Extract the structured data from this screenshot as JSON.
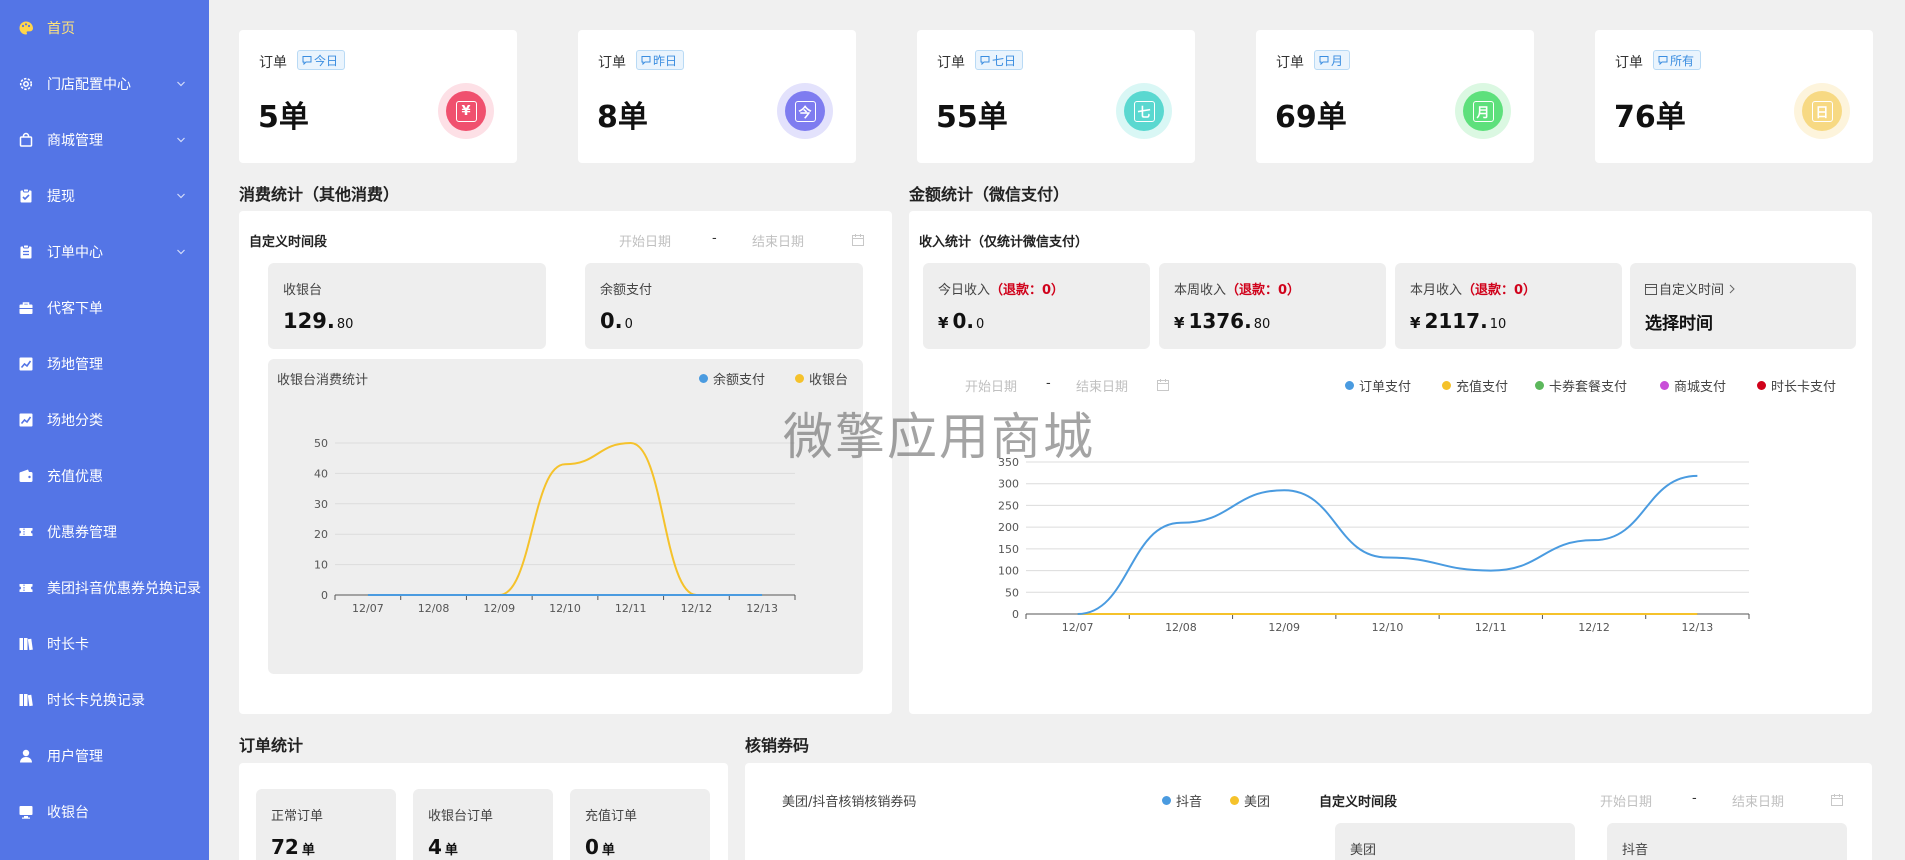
{
  "sidebar": {
    "items": [
      {
        "label": "首页",
        "icon": "palette-icon",
        "active": true,
        "chevron": false
      },
      {
        "label": "门店配置中心",
        "icon": "gear-icon",
        "chevron": true
      },
      {
        "label": "商城管理",
        "icon": "shopping-bag-icon",
        "chevron": true
      },
      {
        "label": "提现",
        "icon": "clipboard-check-icon",
        "chevron": true
      },
      {
        "label": "订单中心",
        "icon": "clipboard-list-icon",
        "chevron": true
      },
      {
        "label": "代客下单",
        "icon": "briefcase-icon",
        "chevron": false
      },
      {
        "label": "场地管理",
        "icon": "chart-up-icon",
        "chevron": false
      },
      {
        "label": "场地分类",
        "icon": "chart-up-icon",
        "chevron": false
      },
      {
        "label": "充值优惠",
        "icon": "wallet-icon",
        "chevron": false
      },
      {
        "label": "优惠券管理",
        "icon": "ticket-icon",
        "chevron": false
      },
      {
        "label": "美团抖音优惠券兑换记录",
        "icon": "ticket-icon",
        "chevron": false
      },
      {
        "label": "时长卡",
        "icon": "card-stack-icon",
        "chevron": false
      },
      {
        "label": "时长卡兑换记录",
        "icon": "card-stack-icon",
        "chevron": false
      },
      {
        "label": "用户管理",
        "icon": "user-icon",
        "chevron": false
      },
      {
        "label": "收银台",
        "icon": "monitor-icon",
        "chevron": false
      }
    ]
  },
  "stats": [
    {
      "title": "订单",
      "tag": "今日",
      "value": "5单",
      "badge_char": "¥",
      "badge_color": "#f0506e",
      "ring_color": "#fde0e6"
    },
    {
      "title": "订单",
      "tag": "昨日",
      "value": "8单",
      "badge_char": "今",
      "badge_color": "#7e7cf0",
      "ring_color": "#e3e2fc"
    },
    {
      "title": "订单",
      "tag": "七日",
      "value": "55单",
      "badge_char": "七",
      "badge_color": "#5ad8d0",
      "ring_color": "#d9f7f5"
    },
    {
      "title": "订单",
      "tag": "月",
      "value": "69单",
      "badge_char": "月",
      "badge_color": "#5ee07c",
      "ring_color": "#dbf8e2"
    },
    {
      "title": "订单",
      "tag": "所有",
      "value": "76单",
      "badge_char": "日",
      "badge_color": "#f7d983",
      "ring_color": "#fdf4dc"
    }
  ],
  "consume": {
    "section_title": "消费统计（其他消费）",
    "range_label": "自定义时间段",
    "start_placeholder": "开始日期",
    "dash": "-",
    "end_placeholder": "结束日期",
    "box1_label": "收银台",
    "box1_int": "129.",
    "box1_dec": "80",
    "box2_label": "余额支付",
    "box2_int": "0.",
    "box2_dec": "0"
  },
  "amount": {
    "section_title": "金额统计（微信支付）",
    "income_label": "收入统计（仅统计微信支付）",
    "boxes": [
      {
        "label": "今日收入",
        "refund": "（退款：0）",
        "currency": "¥",
        "int": "0.",
        "dec": "0"
      },
      {
        "label": "本周收入",
        "refund": "（退款：0）",
        "currency": "¥",
        "int": "1376.",
        "dec": "80"
      },
      {
        "label": "本月收入",
        "refund": "（退款：0）",
        "currency": "¥",
        "int": "2117.",
        "dec": "10"
      }
    ],
    "custom_label": "自定义时间",
    "custom_action": "选择时间",
    "start_placeholder": "开始日期",
    "dash": "-",
    "end_placeholder": "结束日期"
  },
  "watermark": "微擎应用商城",
  "orders": {
    "section_title": "订单统计",
    "boxes": [
      {
        "label": "正常订单",
        "value": "72",
        "unit": "单"
      },
      {
        "label": "收银台订单",
        "value": "4",
        "unit": "单"
      },
      {
        "label": "充值订单",
        "value": "0",
        "unit": "单"
      }
    ]
  },
  "verify": {
    "section_title": "核销券码",
    "chart_title": "美团/抖音核销核销券码",
    "range_label": "自定义时间段",
    "start_placeholder": "开始日期",
    "dash": "-",
    "end_placeholder": "结束日期",
    "box1_label": "美团",
    "box2_label": "抖音"
  },
  "chart_data": [
    {
      "type": "line",
      "title": "收银台消费统计",
      "categories": [
        "12/07",
        "12/08",
        "12/09",
        "12/10",
        "12/11",
        "12/12",
        "12/13"
      ],
      "series": [
        {
          "name": "余额支付",
          "color": "#4a9be0",
          "values": [
            0,
            0,
            0,
            0,
            0,
            0,
            0
          ]
        },
        {
          "name": "收银台",
          "color": "#f5c22b",
          "values": [
            0,
            0,
            0,
            43,
            50,
            0,
            0
          ]
        }
      ],
      "ylim": [
        0,
        50
      ],
      "yticks": [
        0,
        10,
        20,
        30,
        40,
        50
      ],
      "grid": true,
      "legend": "top-right"
    },
    {
      "type": "line",
      "categories": [
        "12/07",
        "12/08",
        "12/09",
        "12/10",
        "12/11",
        "12/12",
        "12/13"
      ],
      "series": [
        {
          "name": "订单支付",
          "color": "#4a9be0",
          "values": [
            0,
            210,
            285,
            130,
            100,
            170,
            318
          ]
        },
        {
          "name": "充值支付",
          "color": "#f5c22b",
          "values": [
            0,
            0,
            0,
            0,
            0,
            0,
            0
          ]
        },
        {
          "name": "卡券套餐支付",
          "color": "#5cb85c",
          "values": [
            0,
            0,
            0,
            0,
            0,
            0,
            0
          ]
        },
        {
          "name": "商城支付",
          "color": "#c94fd8",
          "values": [
            0,
            0,
            0,
            0,
            0,
            0,
            0
          ]
        },
        {
          "name": "时长卡支付",
          "color": "#d0021b",
          "values": [
            0,
            0,
            0,
            0,
            0,
            0,
            0
          ]
        }
      ],
      "ylim": [
        0,
        350
      ],
      "yticks": [
        0,
        50,
        100,
        150,
        200,
        250,
        300,
        350
      ],
      "grid": true,
      "legend": "top-right"
    },
    {
      "type": "line",
      "title": "美团/抖音核销核销券码",
      "series": [
        {
          "name": "抖音",
          "color": "#4a9be0"
        },
        {
          "name": "美团",
          "color": "#f5c22b"
        }
      ],
      "legend": "top-right"
    }
  ]
}
